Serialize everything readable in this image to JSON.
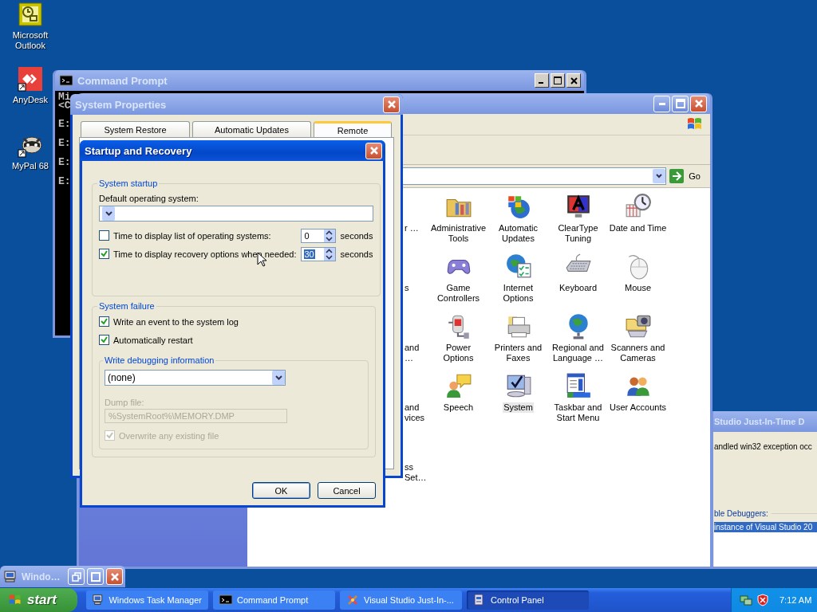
{
  "desktop_icons": [
    {
      "label": "Microsoft Outlook"
    },
    {
      "label": "AnyDesk"
    },
    {
      "label": "MyPal 68"
    }
  ],
  "command_prompt": {
    "title": "Command Prompt",
    "lines": [
      "Mi",
      "<C",
      "E:",
      "E:",
      "E:",
      "E:"
    ]
  },
  "control_panel": {
    "go": "Go",
    "partial_items": [
      {
        "label": "r …"
      },
      {
        "label": "s"
      },
      {
        "label": "and …"
      },
      {
        "label": "and vices"
      },
      {
        "label": "ss Set…"
      }
    ],
    "items": [
      {
        "label": "Administrative Tools",
        "selected": false
      },
      {
        "label": "Automatic Updates",
        "selected": false
      },
      {
        "label": "ClearType Tuning",
        "selected": false
      },
      {
        "label": "Date and Time",
        "selected": false
      },
      {
        "label": "Game Controllers",
        "selected": false
      },
      {
        "label": "Internet Options",
        "selected": false
      },
      {
        "label": "Keyboard",
        "selected": false
      },
      {
        "label": "Mouse",
        "selected": false
      },
      {
        "label": "Power Options",
        "selected": false
      },
      {
        "label": "Printers and Faxes",
        "selected": false
      },
      {
        "label": "Regional and Language …",
        "selected": false
      },
      {
        "label": "Scanners and Cameras",
        "selected": false
      },
      {
        "label": "Speech",
        "selected": false
      },
      {
        "label": "System",
        "selected": true
      },
      {
        "label": "Taskbar and Start Menu",
        "selected": false
      },
      {
        "label": "User Accounts",
        "selected": false
      }
    ]
  },
  "system_properties": {
    "title": "System Properties",
    "tabs": [
      {
        "label": "System Restore",
        "selected": false
      },
      {
        "label": "Automatic Updates",
        "selected": false
      },
      {
        "label": "Remote",
        "selected": true
      }
    ]
  },
  "startup_recovery": {
    "title": "Startup and Recovery",
    "system_startup": {
      "legend": "System startup",
      "default_os_label": "Default operating system:",
      "options": [
        {
          "label": "Time to display list of operating systems:",
          "checked": false,
          "value": "0",
          "value_selected": false,
          "unit": "seconds"
        },
        {
          "label": "Time to display recovery options when needed:",
          "checked": true,
          "value": "30",
          "value_selected": true,
          "unit": "seconds"
        }
      ]
    },
    "system_failure": {
      "legend": "System failure",
      "options": [
        {
          "label": "Write an event to the system log",
          "checked": true
        },
        {
          "label": "Automatically restart",
          "checked": true
        }
      ],
      "debug": {
        "legend": "Write debugging information",
        "selection": "(none)",
        "dump_label": "Dump file:",
        "dump_path": "%SystemRoot%\\MEMORY.DMP",
        "overwrite_label": "Overwrite any existing file",
        "overwrite_checked": true,
        "disabled": true
      }
    },
    "buttons": [
      {
        "label": "OK",
        "default": true
      },
      {
        "label": "Cancel",
        "default": false
      }
    ]
  },
  "jit_debugger": {
    "title": "Studio Just-In-Time D",
    "message": "andled win32 exception occ",
    "list_label": "ble Debuggers:",
    "list_items": [
      {
        "label": "instance of Visual Studio 20",
        "selected": true
      }
    ]
  },
  "minimized_window": {
    "title": "Windo…"
  },
  "taskbar": {
    "start": "start",
    "buttons": [
      {
        "label": "Windows Task Manager",
        "selected": false
      },
      {
        "label": "Command Prompt",
        "selected": false
      },
      {
        "label": "Visual Studio Just-In-...",
        "selected": false
      },
      {
        "label": "Control Panel",
        "selected": true
      }
    ],
    "clock": "7:12 AM"
  }
}
